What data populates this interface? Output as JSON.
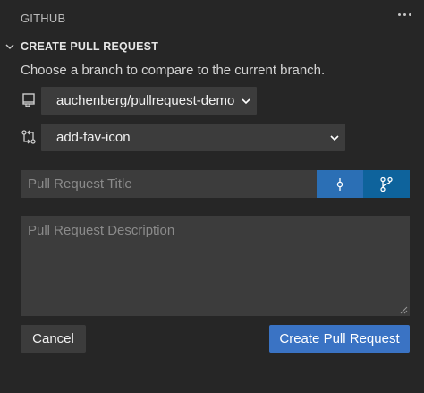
{
  "header": {
    "title": "GITHUB",
    "more_icon": "ellipsis-icon"
  },
  "section": {
    "title": "CREATE PULL REQUEST",
    "chevron_icon": "chevron-down-icon"
  },
  "form": {
    "description": "Choose a branch to compare to the current branch.",
    "repo_select": {
      "icon": "repo-icon",
      "value": "auchenberg/pullrequest-demo"
    },
    "branch_select": {
      "icon": "compare-icon",
      "value": "add-fav-icon"
    },
    "title_placeholder": "Pull Request Title",
    "description_placeholder": "Pull Request Description",
    "title_toggles": [
      {
        "icon": "commit-icon",
        "selected": true
      },
      {
        "icon": "git-branch-icon",
        "selected": false
      }
    ]
  },
  "actions": {
    "cancel_label": "Cancel",
    "create_label": "Create Pull Request"
  },
  "colors": {
    "background": "#262626",
    "input_bg": "#3c3c3c",
    "primary": "#3a73c4"
  }
}
